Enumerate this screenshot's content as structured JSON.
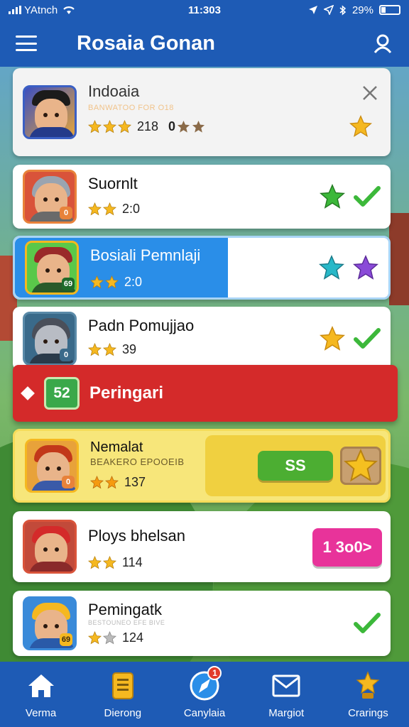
{
  "status_bar": {
    "carrier": "YAtnch",
    "time": "11:303",
    "battery": "29%"
  },
  "header": {
    "title": "Rosaia Gonan",
    "menu_icon": "hamburger-menu-icon",
    "search_icon": "person-search-icon"
  },
  "list": [
    {
      "name": "Indoaia",
      "subtitle": "BANWATOO FOR O18",
      "rating_stars": 3,
      "rating_value": "218",
      "extra_rating_value": "0",
      "extra_stars": 2,
      "actions": [
        "gold-star-icon"
      ],
      "highlight": "none",
      "accent": "#e8a23a"
    },
    {
      "name": "Suornlt",
      "rating_stars": 2,
      "rating_value": "2:0",
      "badge": "0",
      "actions": [
        "green-star-icon",
        "green-check-icon"
      ],
      "highlight": "none",
      "accent": "#d9533a"
    },
    {
      "name": "Bosiali Pemnlaji",
      "rating_stars": 2,
      "rating_value": "2:0",
      "badge": "69",
      "actions": [
        "teal-star-icon",
        "purple-star-icon"
      ],
      "highlight": "blue",
      "accent": "#3aa84a"
    },
    {
      "name": "Padn Pomujjao",
      "rating_stars": 2,
      "rating_value": "39",
      "badge": "0",
      "actions": [
        "gold-star-icon",
        "green-check-icon"
      ],
      "highlight": "none",
      "accent": "#5a8aa8"
    },
    {
      "name": "Nemalat",
      "subtitle": "BEAKERO EPOOEIB",
      "rating_stars": 2,
      "rating_value": "137",
      "badge": "0",
      "button_label": "SS",
      "actions": [
        "badge-star-icon"
      ],
      "highlight": "yellow",
      "accent": "#e8a23a"
    },
    {
      "name": "Ploys bhelsan",
      "rating_stars": 2,
      "rating_value": "114",
      "button_label": "1 3o0>",
      "highlight": "none",
      "accent": "#d9533a"
    },
    {
      "name": "Pemingatk",
      "subtitle": "BESTOUNEO EFE BIVE",
      "rating_stars": 2,
      "rating_value": "124",
      "badge": "69",
      "actions": [
        "green-check-icon"
      ],
      "highlight": "none",
      "accent": "#3a8ad9"
    }
  ],
  "banner": {
    "count": "52",
    "label": "Peringari",
    "icon": "diamond-icon"
  },
  "bottom_nav": [
    {
      "label": "Verma",
      "icon": "home-icon"
    },
    {
      "label": "Dierong",
      "icon": "clipboard-icon"
    },
    {
      "label": "Canylaia",
      "icon": "compass-icon",
      "notification": "1"
    },
    {
      "label": "Margiot",
      "icon": "mail-icon"
    },
    {
      "label": "Crarings",
      "icon": "trophy-icon"
    }
  ],
  "colors": {
    "primary": "#1e5bb5",
    "banner": "#d42a2a",
    "highlight_blue": "#2a8ee8",
    "highlight_yellow": "#f5dc5a",
    "green_button": "#4cae32",
    "pink_button": "#e8339a",
    "star_gold": "#f5b820"
  }
}
